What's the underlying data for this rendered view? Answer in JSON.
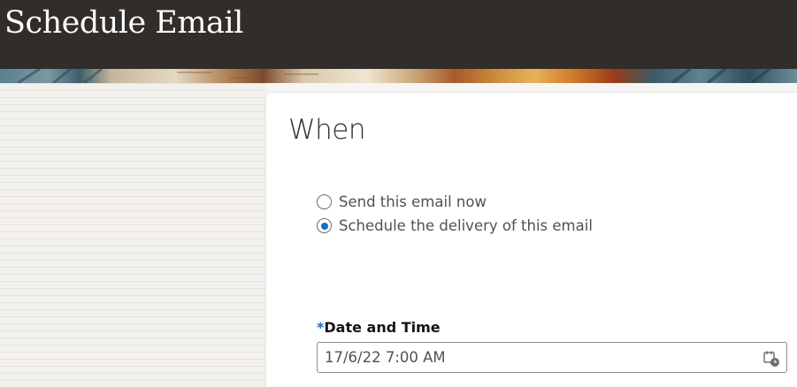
{
  "header": {
    "title": "Schedule Email"
  },
  "section": {
    "title": "When"
  },
  "delivery_options": [
    {
      "label": "Send this email now",
      "checked": false
    },
    {
      "label": "Schedule the delivery of this email",
      "checked": true
    }
  ],
  "date_field": {
    "required_marker": "*",
    "label": "Date and Time",
    "value": "17/6/22 7:00 AM"
  },
  "icons": {
    "calendar": "calendar-clock-icon"
  },
  "colors": {
    "header_bg": "#312d2a",
    "accent": "#1b6cc7"
  }
}
